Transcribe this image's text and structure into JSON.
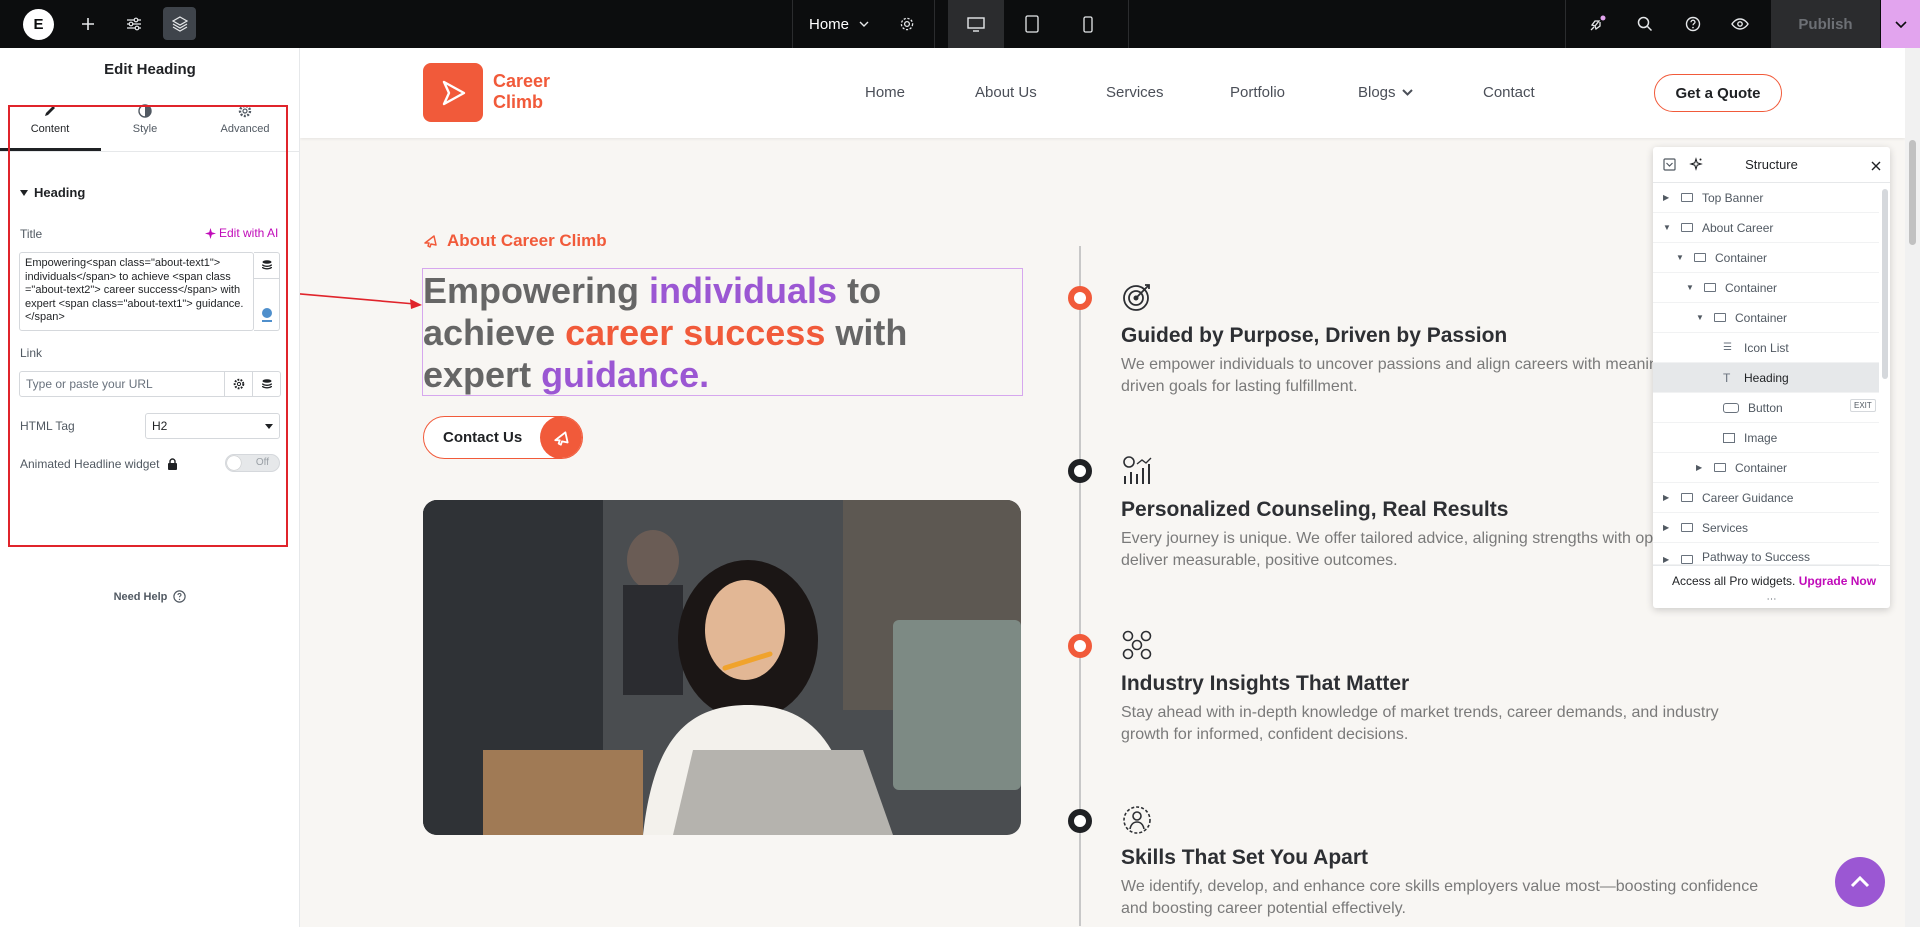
{
  "topbar": {
    "logo": "E",
    "page_name": "Home",
    "publish_label": "Publish"
  },
  "panel": {
    "title": "Edit Heading",
    "tabs": [
      {
        "label": "Content"
      },
      {
        "label": "Style"
      },
      {
        "label": "Advanced"
      }
    ],
    "section": "Heading",
    "title_label": "Title",
    "edit_ai_label": "Edit with AI",
    "title_value": "Empowering<span class=\"about-text1\"> individuals</span> to achieve <span class =\"about-text2\"> career success</span> with expert <span class=\"about-text1\"> guidance.</span>",
    "link_label": "Link",
    "link_placeholder": "Type or paste your URL",
    "html_tag_label": "HTML Tag",
    "html_tag_value": "H2",
    "animated_label": "Animated Headline widget",
    "toggle_label": "Off",
    "need_help": "Need Help"
  },
  "site": {
    "logo_name_line1": "Career",
    "logo_name_line2": "Climb",
    "nav": [
      "Home",
      "About Us",
      "Services",
      "Portfolio",
      "Blogs",
      "Contact"
    ],
    "quote_button": "Get a Quote",
    "kicker": "About Career Climb",
    "heading": {
      "p1": "Empowering ",
      "p2": "individuals",
      "p3": " to achieve ",
      "p4": "career success",
      "p5": " with expert ",
      "p6": "guidance."
    },
    "contact_button": "Contact Us",
    "features": [
      {
        "title": "Guided by Purpose, Driven by Passion",
        "desc": "We empower individuals to uncover passions and align careers with meaningful, purpose-driven goals for lasting fulfillment."
      },
      {
        "title": "Personalized Counseling, Real Results",
        "desc": "Every journey is unique. We offer tailored advice, aligning strengths with opportunities to deliver measurable, positive outcomes."
      },
      {
        "title": "Industry Insights That Matter",
        "desc": "Stay ahead with in-depth knowledge of market trends, career demands, and industry growth for informed, confident decisions."
      },
      {
        "title": "Skills That Set You Apart",
        "desc": "We identify, develop, and enhance core skills employers value most—boosting confidence and boosting career potential effectively."
      }
    ]
  },
  "structure": {
    "title": "Structure",
    "items": [
      {
        "label": "Top Banner"
      },
      {
        "label": "About Career"
      },
      {
        "label": "Container"
      },
      {
        "label": "Container"
      },
      {
        "label": "Container"
      },
      {
        "label": "Icon List"
      },
      {
        "label": "Heading"
      },
      {
        "label": "Button"
      },
      {
        "label": "Image"
      },
      {
        "label": "Container"
      },
      {
        "label": "Career Guidance"
      },
      {
        "label": "Services"
      },
      {
        "label": "Pathway to Success"
      }
    ],
    "exit_badge": "EXIT",
    "promo_text": "Access all Pro widgets.",
    "promo_link": "Upgrade Now"
  },
  "colors": {
    "accent_orange": "#f15a3a",
    "accent_purple": "#9b57d3",
    "elementor_pink": "#c00bb9",
    "topbar_bg": "#0c0d0e"
  }
}
